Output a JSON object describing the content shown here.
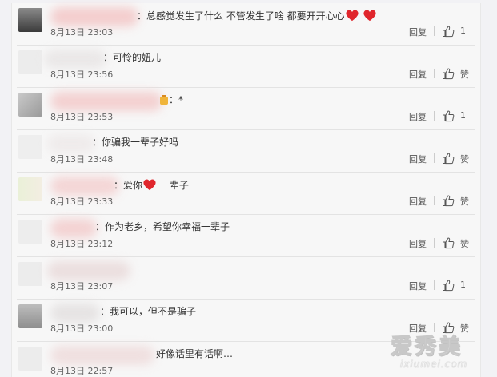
{
  "comments": [
    {
      "text": "：总感觉发生了什么 不管发生了啥 都要开开心心",
      "hearts": 2,
      "time": "8月13日 23:03",
      "reply": "回复",
      "likes": "1"
    },
    {
      "text": "：可怜的妞儿",
      "hearts": 0,
      "time": "8月13日 23:56",
      "reply": "回复",
      "likes": "赞"
    },
    {
      "text": "：*",
      "hearts": 0,
      "time": "8月13日 23:53",
      "reply": "回复",
      "likes": "1"
    },
    {
      "text": "：你骗我一辈子好吗",
      "hearts": 0,
      "time": "8月13日 23:48",
      "reply": "回复",
      "likes": "赞"
    },
    {
      "text_before": "：爱你",
      "text_after": " 一辈子",
      "hearts": 1,
      "time": "8月13日 23:33",
      "reply": "回复",
      "likes": "赞"
    },
    {
      "text": "：作为老乡，希望你幸福一辈子",
      "hearts": 0,
      "time": "8月13日 23:12",
      "reply": "回复",
      "likes": "赞"
    },
    {
      "text": "",
      "hearts": 0,
      "time": "8月13日 23:07",
      "reply": "回复",
      "likes": "1"
    },
    {
      "text": "：我可以，但不是骗子",
      "hearts": 0,
      "time": "8月13日 23:00",
      "reply": "回复",
      "likes": "赞"
    },
    {
      "text": "好像话里有话啊…",
      "hearts": 0,
      "time": "8月13日 22:57",
      "reply": "",
      "likes": ""
    }
  ],
  "watermark": {
    "main": "爱秀美",
    "sub": "ixiumei.com"
  },
  "colors": {
    "heart": "#e0262c",
    "separator": "#e3e3e3",
    "text": "#333333",
    "muted": "#666666"
  }
}
